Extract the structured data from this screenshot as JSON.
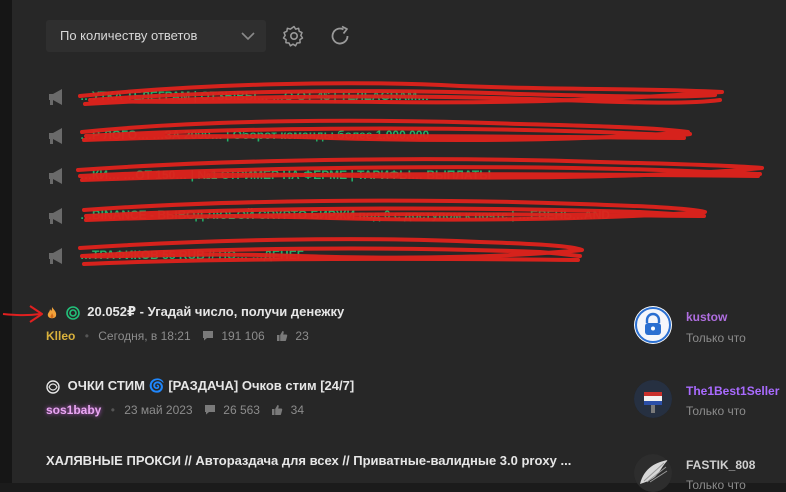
{
  "toolbar": {
    "sort_value": "По количеству ответов",
    "settings_icon": "gear-icon",
    "refresh_icon": "refresh-icon"
  },
  "ads": [
    {
      "text": "…УТКА ТЕЛЕГРАМ | ОТЗЫВЫ… …О ОТ 4$ | ТЕЛЕАGRАМ…"
    },
    {
      "text": "…Р ЛОГО… …ЗА 2000… | Оборот команды более 1.000.000"
    },
    {
      "text": "…КИ… …ОТ 150… | №1 СТРИМЕР НА ФЕРМЕ | ТАРИФЫ… ВЫПЛАТЫ"
    },
    {
      "text": "…BINANCE - ВЫВОД ЛЮБОЙ CRYPTO БИРЖИ под 0 с доступом к почте | …ЕВЕНЬ…AND"
    },
    {
      "text": "…ТРАФИКОВ 55 RUB // ПО… …ДЕНЕГ"
    }
  ],
  "threads": [
    {
      "title": "20.052₽ - Угадай число, получи денежку",
      "author": "Klleo",
      "date": "Сегодня, в 18:21",
      "replies": "191 106",
      "likes": "23",
      "last_user": "kustow",
      "last_time": "Только что"
    },
    {
      "title": "ОЧКИ СТИМ 🌀 [РАЗДАЧА] Очков стим [24/7]",
      "author": "sos1baby",
      "date": "23 май 2023",
      "replies": "26 563",
      "likes": "34",
      "last_user": "The1Best1Seller",
      "last_time": "Только что"
    },
    {
      "title": "ХАЛЯВНЫЕ ПРОКСИ // Авторaздача для всех // Приватные-валидные 3.0 proxy ...",
      "last_user": "FASTIK_808",
      "last_time": "Только что"
    }
  ],
  "colors": {
    "ad_green": "#21b26a",
    "scribble_red": "#e0221c",
    "author_klleo": "#d9b13c",
    "author_sos1baby": "#e9a6f2",
    "user_kustow": "#b06ee0",
    "user_best": "#a96bff",
    "arrow_red": "#e02020"
  }
}
